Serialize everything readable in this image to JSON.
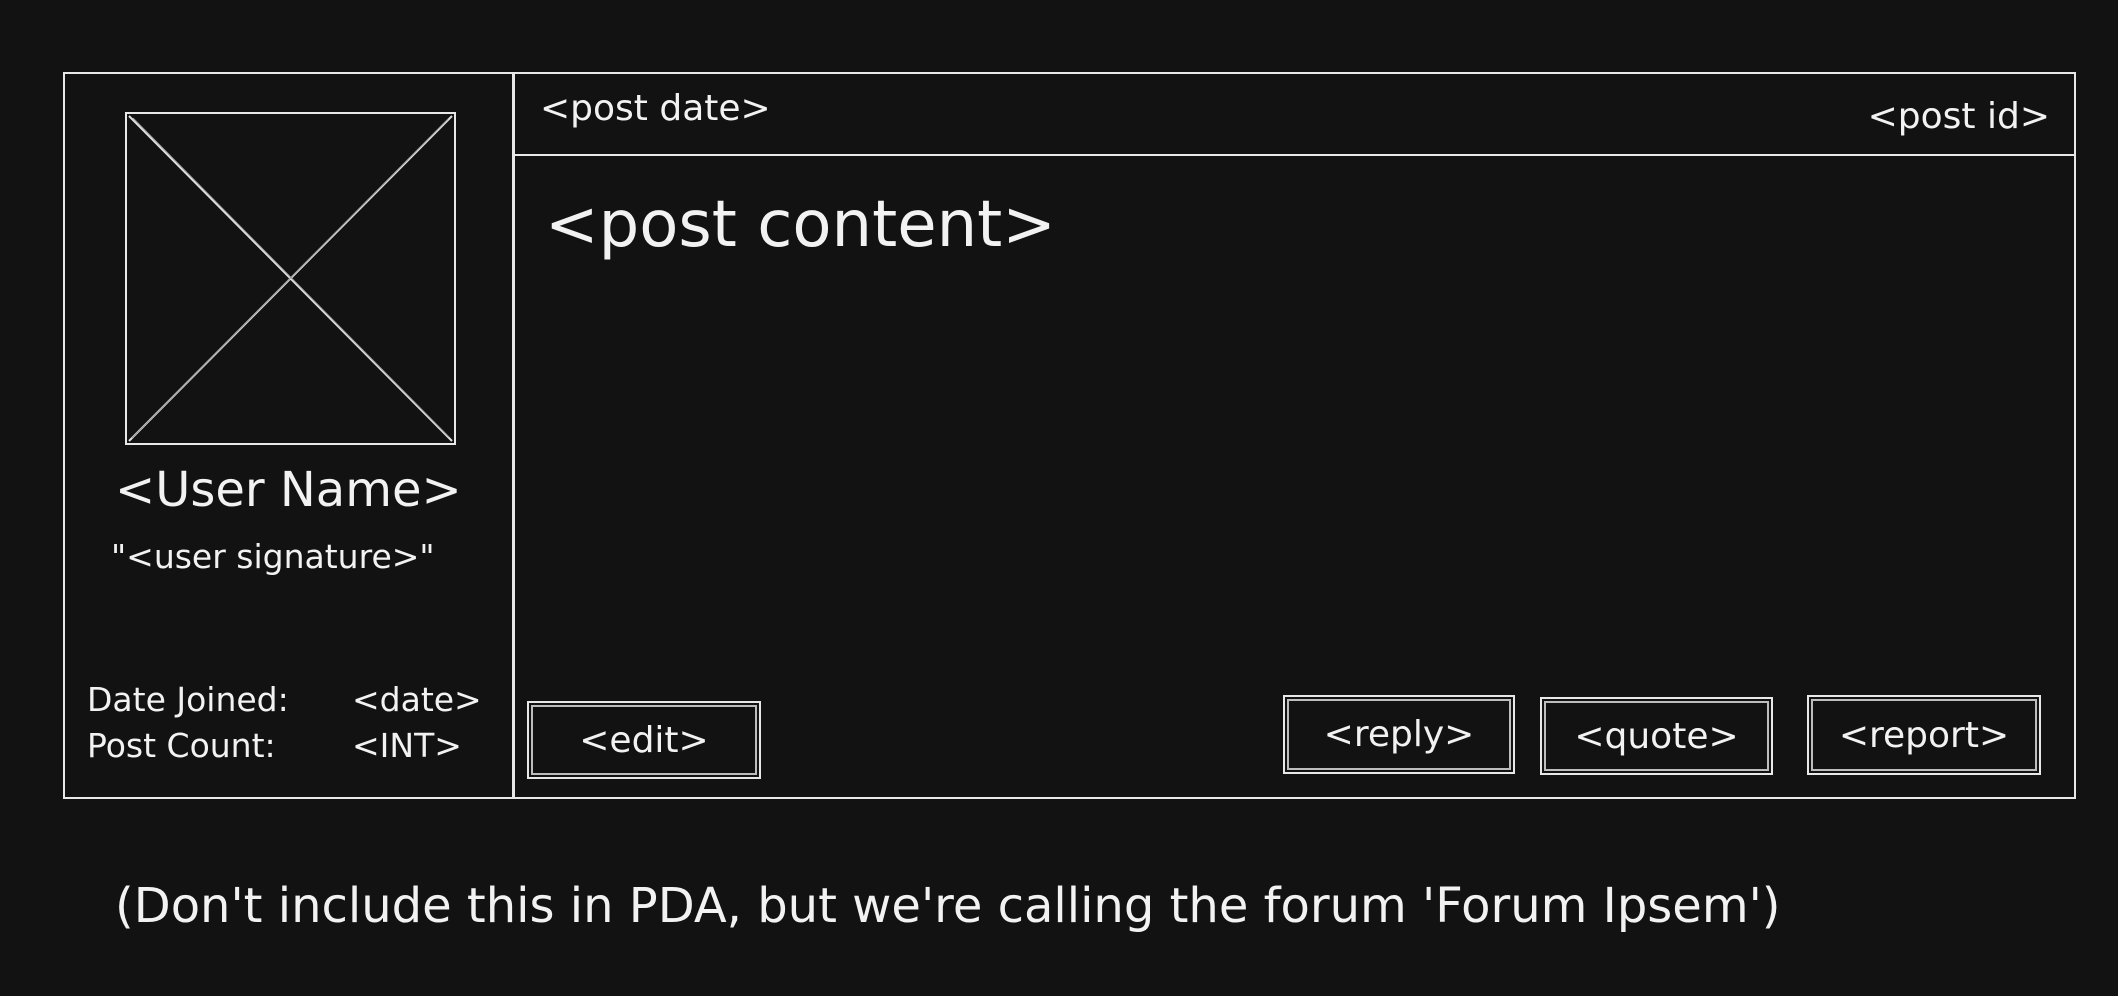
{
  "user_panel": {
    "user_name": "<User Name>",
    "user_signature": "\"<user signature>\"",
    "date_joined_label": "Date Joined:",
    "date_joined_value": "<date>",
    "post_count_label": "Post Count:",
    "post_count_value": "<INT>",
    "avatar_icon": "image-placeholder"
  },
  "post": {
    "date": "<post date>",
    "id": "<post id>",
    "content": "<post content>"
  },
  "actions": {
    "edit": "<edit>",
    "reply": "<reply>",
    "quote": "<quote>",
    "report": "<report>"
  },
  "note": "(Don't include this in PDA, but we're calling the forum 'Forum Ipsem')"
}
